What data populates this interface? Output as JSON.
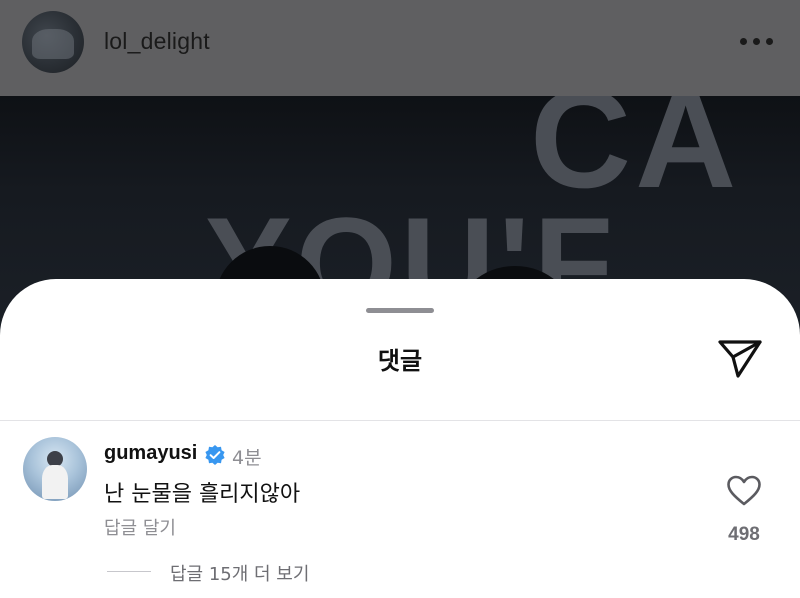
{
  "post": {
    "username": "lol_delight",
    "avatar_icon": "profile-photo",
    "more_icon": "more-horizontal-icon"
  },
  "post_image": {
    "overlay_text_top": "CA",
    "overlay_text_bottom": "YOU'F"
  },
  "comments_sheet": {
    "title": "댓글",
    "share_icon": "send-icon",
    "comments": [
      {
        "username": "gumayusi",
        "verified": true,
        "time": "4분",
        "text": "난 눈물을 흘리지않아",
        "reply_label": "답글 달기",
        "likes": "498",
        "view_replies_label": "답글 15개 더 보기"
      }
    ]
  },
  "colors": {
    "sheet_bg": "#ffffff",
    "verified_blue": "#3897f0",
    "secondary_text": "#8e8e93",
    "dim_header": "#5f5f61"
  }
}
